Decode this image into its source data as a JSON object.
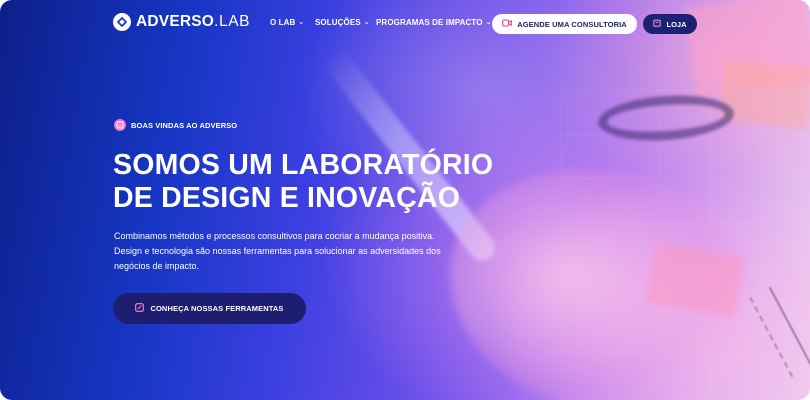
{
  "brand": {
    "name": "ADVERSO",
    "suffix": ".LAB"
  },
  "nav": {
    "items": [
      {
        "label": "O LAB"
      },
      {
        "label": "SOLUÇÕES"
      },
      {
        "label": "PROGRAMAS DE IMPACTO"
      }
    ],
    "cta_primary": {
      "label": "AGENDE UMA CONSULTORIA",
      "icon": "video-icon"
    },
    "cta_store": {
      "label": "LOJA",
      "icon": "shopping-bag-icon"
    }
  },
  "hero": {
    "badge": {
      "label": "BOAS VINDAS AO ADVERSO",
      "icon": "smile-icon"
    },
    "headline": [
      "SOMOS UM LABORATÓRIO",
      "DE DESIGN E INOVAÇÃO"
    ],
    "description": "Combinamos métodos e processos consultivos para cocriar a mudança positiva. Design e tecnologia são nossas ferramentas para solucionar as adversidades dos negócios de impacto.",
    "cta": {
      "label": "CONHEÇA NOSSAS FERRAMENTAS",
      "icon": "edit-icon"
    }
  },
  "colors": {
    "accent_pink": "#ec7bd0",
    "navy_button": "#1c2173",
    "gradient_start": "#0c1f8a",
    "gradient_end": "#f1cff0"
  }
}
